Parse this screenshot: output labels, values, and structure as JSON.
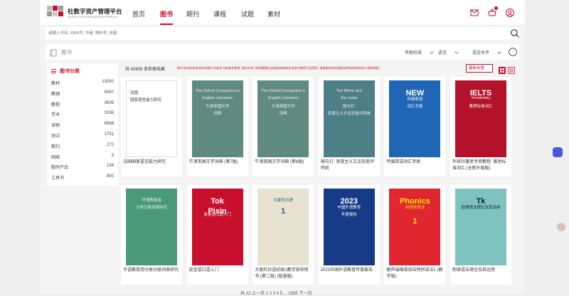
{
  "header": {
    "brand": "社数字资产管理平台",
    "brand_sub": "Digital Asset Management Platform",
    "nav": [
      "首页",
      "图书",
      "期刊",
      "课程",
      "试题",
      "素材"
    ],
    "active_nav": "图书"
  },
  "search": {
    "placeholder": "请输入书名, ISBN号, 作者, 物料号, 译者"
  },
  "filterbar": {
    "title": "图书",
    "filters": [
      "年龄阶段",
      "语言",
      "语言水平"
    ],
    "more": "···"
  },
  "sidebar": {
    "title": "图书分类",
    "items": [
      {
        "label": "教材",
        "count": "13540"
      },
      {
        "label": "教辅",
        "count": "8367"
      },
      {
        "label": "教程",
        "count": "3608"
      },
      {
        "label": "学术",
        "count": "3336"
      },
      {
        "label": "读物",
        "count": "8568"
      },
      {
        "label": "测试",
        "count": "1751"
      },
      {
        "label": "期刊",
        "count": "272"
      },
      {
        "label": "网络",
        "count": "3"
      },
      {
        "label": "数码产品",
        "count": "134"
      },
      {
        "label": "工具书",
        "count": "800"
      }
    ]
  },
  "results": {
    "count_text": "共 40609 条检索结果",
    "note": "*本平台内的所有资料仅限于内部学习和参考使用, 请勿外传, 如您需要在出版或其他商业用途中使用平台资料, 请按照资料的版权说明向相关权利人获取授权。",
    "sort": "最新出版"
  },
  "books": [
    {
      "title": "法国国家语言能力研究",
      "cover_lines": [
        "法国",
        "国家语言能力研究"
      ]
    },
    {
      "title": "牛津英国文学词典 (第7版)",
      "cover_lines": [
        "The Oxford Companion to",
        "English Literature",
        "牛津英国文学",
        "词典"
      ]
    },
    {
      "title": "牛津英国文学词典 (第6版)",
      "cover_lines": [
        "The Oxford Companion to",
        "English Literature",
        "牛津英国文学",
        "词典"
      ]
    },
    {
      "title": "镜与灯: 浪漫主义文论及批评传统",
      "cover_lines": [
        "The Mirror and",
        "the Lamp",
        "镜与灯:",
        "浪漫主义文论及批评传统"
      ]
    },
    {
      "title": "传媒英语词汇手册",
      "cover_lines": [
        "NEW",
        "传媒英语",
        "词汇手册"
      ]
    },
    {
      "title": "外研社雅思专项教程: 雅思标准词汇 (全新升级版)",
      "cover_lines": [
        "IELTS",
        "Vocabulary",
        "雅思标准词汇"
      ]
    },
    {
      "title": "华语教育用分类分级词表研究",
      "cover_lines": [
        "华语教育用",
        "分类分级词表研究"
      ]
    },
    {
      "title": "皮金语口语入门",
      "cover_lines": [
        "Tok",
        "Pisin",
        "皮金语口语入门"
      ]
    },
    {
      "title": "大家的日语初级1教学指导用书 (第二版) (智慧版)",
      "cover_lines": [
        "大家的日语",
        "1"
      ]
    },
    {
      "title": "2023中国外语教育年度报告",
      "cover_lines": [
        "2023",
        "中国外语教育",
        "年度报告"
      ]
    },
    {
      "title": "丽声瑞格叔叔自然拼读法1 (教学版)",
      "cover_lines": [
        "Phonics",
        "自然拼读法",
        "1"
      ]
    },
    {
      "title": "韵律语法理论及其运用",
      "cover_lines": [
        "Tk",
        "韵律语法理论及其运用"
      ]
    }
  ],
  "pager": {
    "text": "1 2 3 4 5 ... 2385",
    "prev": "上一页",
    "next": "下一页",
    "total": "共 12"
  },
  "colors": {
    "accent": "#c8102e",
    "page_bg": "#f4f4f4"
  }
}
